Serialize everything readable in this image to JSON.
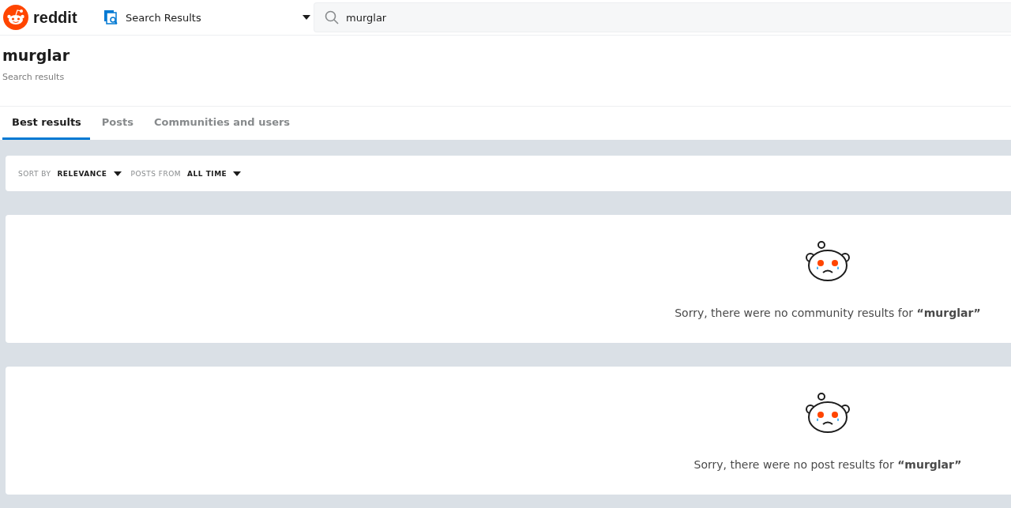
{
  "header": {
    "logo_text": "reddit",
    "location": "Search Results",
    "search": {
      "value": "murglar"
    }
  },
  "title": "murglar",
  "subtitle": "Search results",
  "tabs": [
    {
      "label": "Best results",
      "selected": true
    },
    {
      "label": "Posts",
      "selected": false
    },
    {
      "label": "Communities and users",
      "selected": false
    }
  ],
  "filters": [
    {
      "label": "SORT BY",
      "value": "RELEVANCE"
    },
    {
      "label": "POSTS FROM",
      "value": "ALL TIME"
    }
  ],
  "empty_results": [
    {
      "message": "Sorry, there were no community results for **“murglar”**"
    },
    {
      "message": "Sorry, there were no post results for **“murglar”**"
    }
  ]
}
